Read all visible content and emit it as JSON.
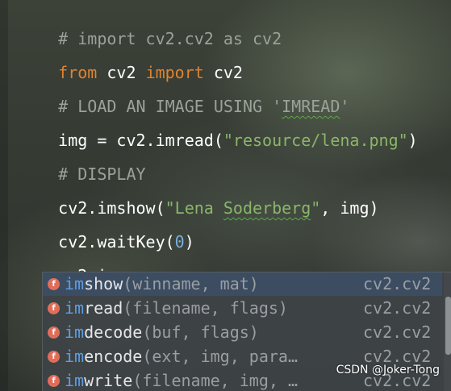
{
  "code_lines": [
    {
      "comment": "# import cv2.cv2 as cv2"
    },
    {
      "kw1": "from",
      "mid": " cv2 ",
      "kw2": "import",
      "tail": " cv2"
    },
    {
      "comment_pre": "# LOAD AN IMAGE USING '",
      "comment_typo": "IMREAD",
      "comment_post": "'"
    },
    {
      "pre": "img = cv2.imread(",
      "str": "\"resource/lena.png\"",
      "post": ")"
    },
    {
      "comment": "# DISPLAY"
    },
    {
      "pre": "cv2.imshow(",
      "str_pre": "\"Lena ",
      "str_typo": "Soderberg",
      "str_post": "\"",
      "post": ", img)"
    },
    {
      "pre": "cv2.waitKey(",
      "num": "0",
      "post": ")"
    },
    {
      "text": "cv2.im"
    }
  ],
  "completion": {
    "items": [
      {
        "icon": "f",
        "match": "im",
        "rest": "show",
        "params": "(winname, mat)",
        "module": "cv2.cv2"
      },
      {
        "icon": "f",
        "match": "im",
        "rest": "read",
        "params": "(filename, flags)",
        "module": "cv2.cv2"
      },
      {
        "icon": "f",
        "match": "im",
        "rest": "decode",
        "params": "(buf, flags)",
        "module": "cv2.cv2"
      },
      {
        "icon": "f",
        "match": "im",
        "rest": "encode",
        "params": "(ext, img, para…",
        "module": "cv2.cv2"
      },
      {
        "icon": "f",
        "match": "im",
        "rest": "write",
        "params": "(filename, img, …",
        "module": "cv2.cv2"
      }
    ]
  },
  "watermark": "CSDN @Joker-Tong",
  "colors": {
    "keyword": "#e0832f",
    "string": "#8ab66a",
    "number": "#7aaee0",
    "comment": "#9aa29a",
    "match": "#5c9fe6",
    "function_icon": "#e16d59",
    "selection": "#3c4d62"
  }
}
